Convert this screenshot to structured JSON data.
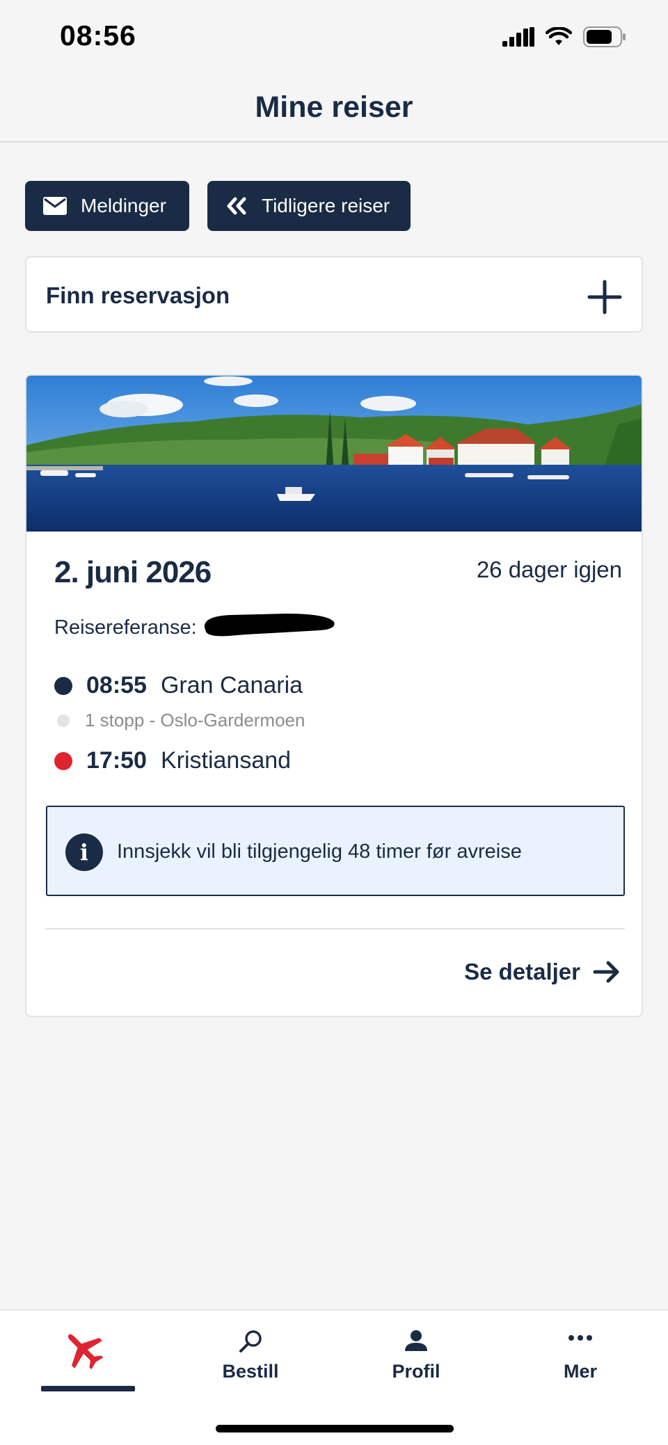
{
  "status_bar": {
    "time": "08:56"
  },
  "header": {
    "title": "Mine reiser"
  },
  "actions": {
    "messages_label": "Meldinger",
    "previous_trips_label": "Tidligere reiser"
  },
  "find_reservation": {
    "label": "Finn reservasjon"
  },
  "trip": {
    "date": "2. juni 2026",
    "days_left": "26 dager igjen",
    "reference_label": "Reisereferanse:",
    "departure": {
      "time": "08:55",
      "place": "Gran Canaria"
    },
    "stop": "1 stopp - Oslo-Gardermoen",
    "arrival": {
      "time": "17:50",
      "place": "Kristiansand"
    },
    "info": {
      "icon": "info-icon",
      "text": "Innsjekk vil bli tilgjengelig 48 timer før avreise"
    },
    "details_label": "Se detaljer"
  },
  "tab_bar": {
    "tabs": [
      {
        "icon": "airplane-icon",
        "label": "",
        "active": true
      },
      {
        "icon": "search-icon",
        "label": "Bestill",
        "active": false
      },
      {
        "icon": "profile-icon",
        "label": "Profil",
        "active": false
      },
      {
        "icon": "more-icon",
        "label": "Mer",
        "active": false
      }
    ]
  },
  "colors": {
    "navy": "#1a2b45",
    "departure_dot": "#1a2b45",
    "arrival_dot": "#e0242f",
    "brand_red": "#e0242f",
    "info_bg": "#eaf2fd"
  }
}
